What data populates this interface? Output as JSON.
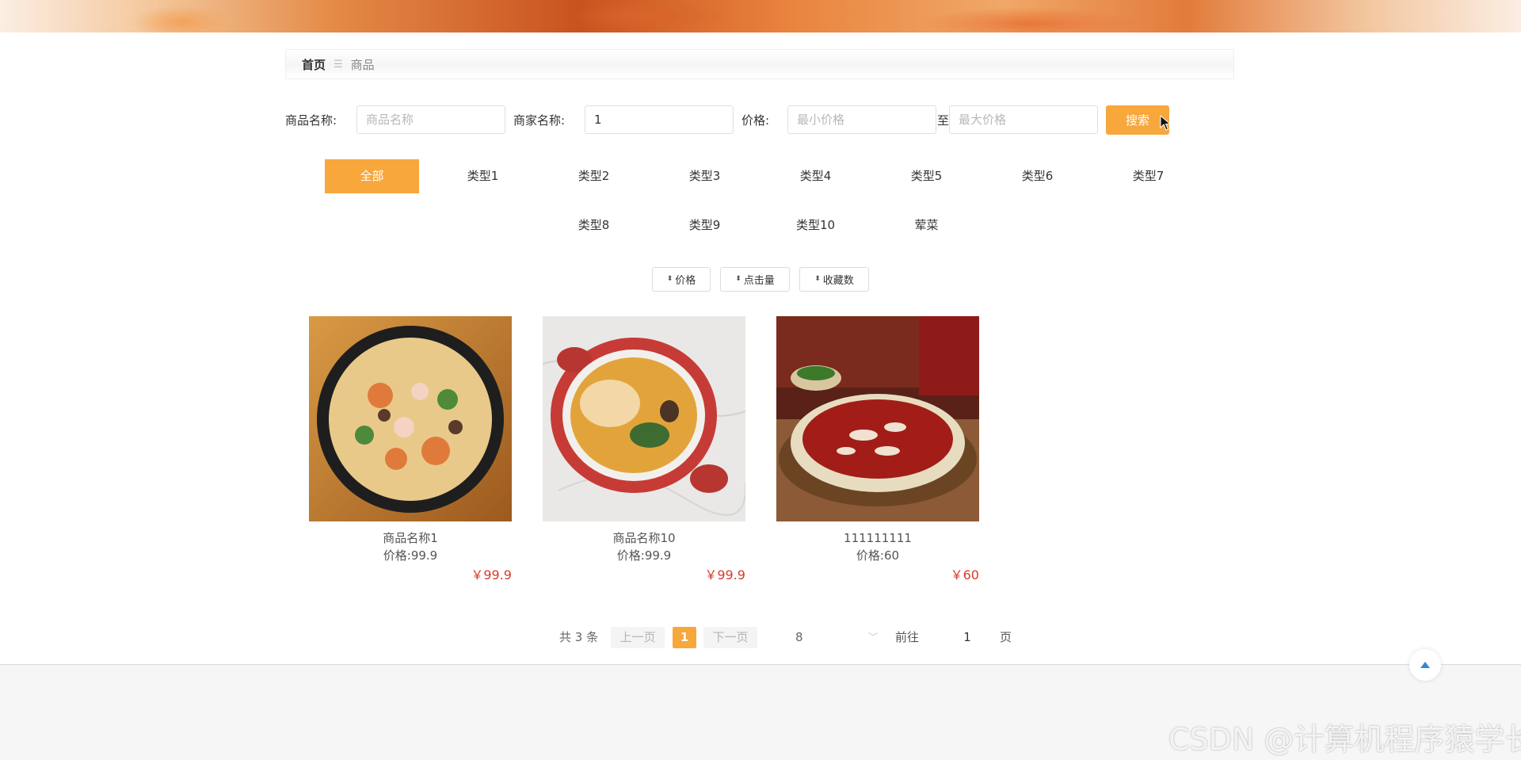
{
  "breadcrumb": {
    "home": "首页",
    "separator": "☰",
    "current": "商品"
  },
  "search": {
    "product_name_label": "商品名称:",
    "product_name_placeholder": "商品名称",
    "product_name_value": "",
    "merchant_name_label": "商家名称:",
    "merchant_name_placeholder": "商家名称",
    "merchant_name_value": "1",
    "price_label": "价格:",
    "min_price_placeholder": "最小价格",
    "to_label": "至",
    "max_price_placeholder": "最大价格",
    "search_button": "搜索"
  },
  "categories": [
    "全部",
    "类型1",
    "类型2",
    "类型3",
    "类型4",
    "类型5",
    "类型6",
    "类型7",
    "类型8",
    "类型9",
    "类型10",
    "荤菜"
  ],
  "active_category": "全部",
  "sort_buttons": [
    "价格",
    "点击量",
    "收藏数"
  ],
  "products": [
    {
      "name": "商品名称1",
      "price_text": "价格:99.9",
      "price_tag": "￥99.9"
    },
    {
      "name": "商品名称10",
      "price_text": "价格:99.9",
      "price_tag": "￥99.9"
    },
    {
      "name": "111111111",
      "price_text": "价格:60",
      "price_tag": "￥60"
    }
  ],
  "pagination": {
    "total": "共 3 条",
    "prev": "上一页",
    "current": "1",
    "next": "下一页",
    "page_size": "8",
    "goto_label": "前往",
    "goto_value": "1",
    "page_suffix": "页"
  },
  "watermark": "CSDN @计算机程序猿学长",
  "colors": {
    "accent": "#f7a73c",
    "price": "#d83a2b"
  }
}
